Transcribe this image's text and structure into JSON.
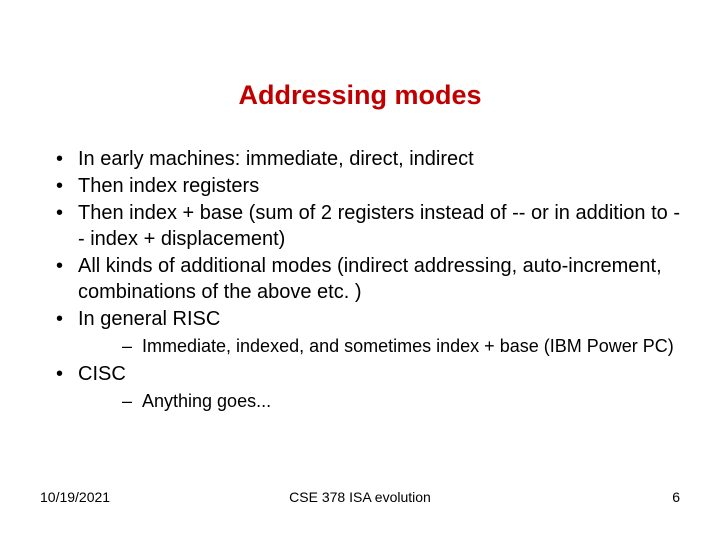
{
  "slide": {
    "title": "Addressing modes",
    "bullets": [
      {
        "text": "In early machines: immediate, direct, indirect",
        "sub": []
      },
      {
        "text": "Then index registers",
        "sub": []
      },
      {
        "text": "Then index + base (sum of 2 registers instead of -- or in addition to -- index + displacement)",
        "sub": []
      },
      {
        "text": "All kinds of additional modes (indirect addressing, auto-increment, combinations of the above etc. )",
        "sub": []
      },
      {
        "text": "In general RISC",
        "sub": [
          "Immediate, indexed, and sometimes index + base (IBM Power PC)"
        ]
      },
      {
        "text": "CISC",
        "sub": [
          "Anything goes..."
        ]
      }
    ]
  },
  "footer": {
    "date": "10/19/2021",
    "center": "CSE 378 ISA evolution",
    "page": "6"
  }
}
